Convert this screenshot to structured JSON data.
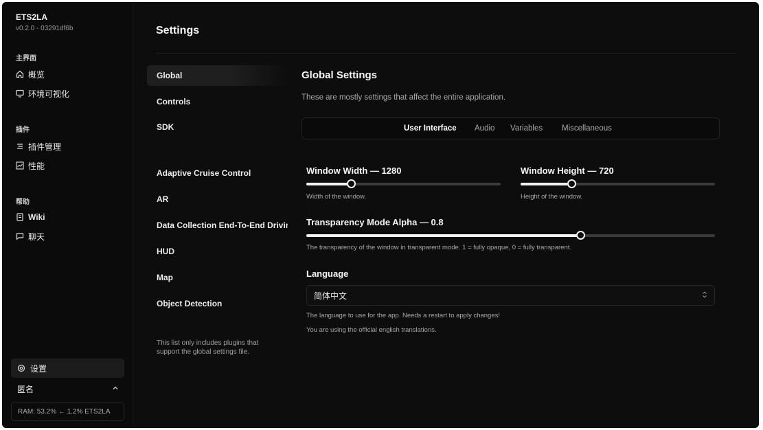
{
  "app": {
    "name": "ETS2LA",
    "version": "v0.2.0 - 03291df6b"
  },
  "window_controls": {
    "colors": [
      "#22c55e",
      "#eab308",
      "#ef4444"
    ]
  },
  "sidebar": {
    "sections": [
      {
        "title": "主界面",
        "items": [
          {
            "label": "概览",
            "icon": "home-icon"
          },
          {
            "label": "环境可视化",
            "icon": "monitor-icon"
          }
        ]
      },
      {
        "title": "插件",
        "items": [
          {
            "label": "插件管理",
            "icon": "list-icon"
          },
          {
            "label": "性能",
            "icon": "chart-icon"
          }
        ]
      },
      {
        "title": "帮助",
        "items": [
          {
            "label": "Wiki",
            "icon": "book-icon"
          },
          {
            "label": "聊天",
            "icon": "chat-icon"
          }
        ]
      }
    ],
    "settings_label": "设置",
    "account_label": "匿名",
    "ram_status": "RAM: 53.2% ← 1.2% ETS2LA"
  },
  "main": {
    "title": "Settings",
    "plugins": [
      "Global",
      "Controls",
      "SDK",
      "Adaptive Cruise Control",
      "AR",
      "Data Collection End-To-End Driving",
      "HUD",
      "Map",
      "Object Detection"
    ],
    "active_plugin": "Global",
    "plugin_note": "This list only includes plugins that support the global settings file.",
    "panel": {
      "title": "Global Settings",
      "description": "These are mostly settings that affect the entire application.",
      "tabs": [
        "User Interface",
        "Audio",
        "Variables",
        "Miscellaneous"
      ],
      "active_tab": "User Interface",
      "settings": {
        "window_width": {
          "label": "Window Width — 1280",
          "description": "Width of the window.",
          "fill": 0.23
        },
        "window_height": {
          "label": "Window Height — 720",
          "description": "Height of the window.",
          "fill": 0.26
        },
        "transparency": {
          "label": "Transparency Mode Alpha — 0.8",
          "description": "The transparency of the window in transparent mode. 1 = fully opaque, 0 = fully transparent.",
          "fill": 0.67
        },
        "language": {
          "label": "Language",
          "value": "简体中文",
          "description": "The language to use for the app. Needs a restart to apply changes!",
          "note": "You are using the official english translations."
        }
      }
    }
  }
}
